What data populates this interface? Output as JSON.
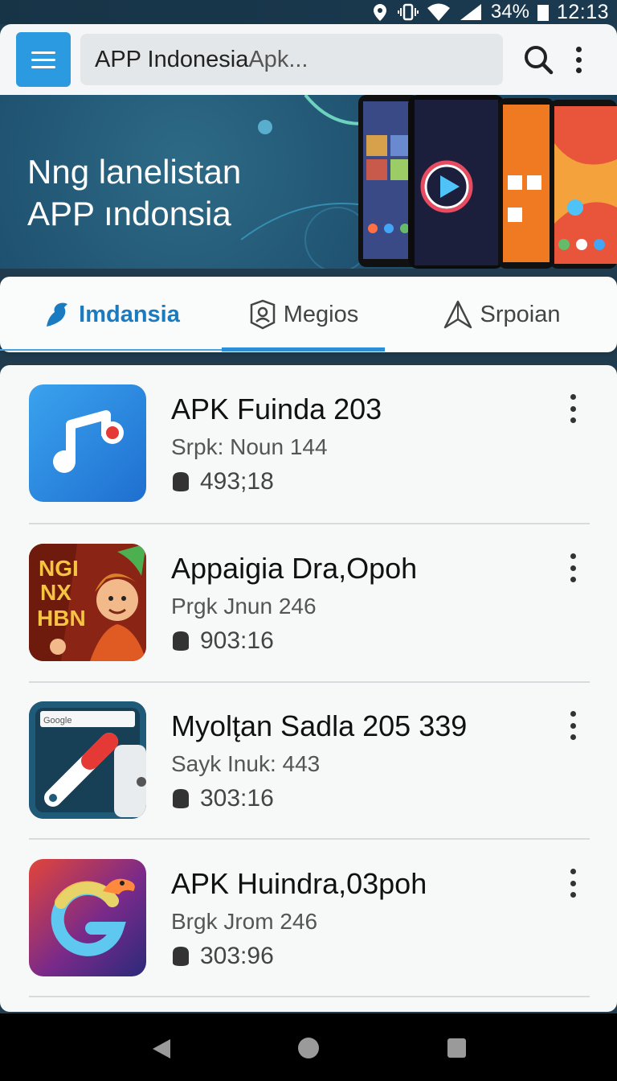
{
  "status_bar": {
    "battery": "34%",
    "time": "12:13"
  },
  "app_bar": {
    "search_text": "APP Indonesia",
    "search_placeholder": " Apk..."
  },
  "banner": {
    "line1": "Nng lanelistan",
    "line2": "APP ındonsia"
  },
  "tabs": [
    {
      "label": "Imdansia",
      "active": true
    },
    {
      "label": "Megios"
    },
    {
      "label": "Srpoian"
    }
  ],
  "apps": [
    {
      "title": "APK Fuinda 203",
      "subtitle": "Srpk: Noun 144",
      "meta": "493;18",
      "icon": "music-app-icon"
    },
    {
      "title": "Appaigia Dra,Opoh",
      "subtitle": "Prgk Jnun 246",
      "meta": "903:16",
      "icon": "cartoon-game-icon",
      "icon_text": [
        "NGI",
        "NX",
        "HBN"
      ]
    },
    {
      "title": "Myolt̨an Sadla 205 339",
      "subtitle": "Sayk Inuk: 443",
      "meta": "303:16",
      "icon": "browser-tool-icon",
      "icon_text": "Google"
    },
    {
      "title": "APK Huindra,03poh",
      "subtitle": "Brgk Jrom 246",
      "meta": "303:96",
      "icon": "g-letter-app-icon"
    }
  ],
  "colors": {
    "accent": "#2c9ae0",
    "active_tab": "#1a7bc1",
    "banner_bg": "#1f5270"
  }
}
